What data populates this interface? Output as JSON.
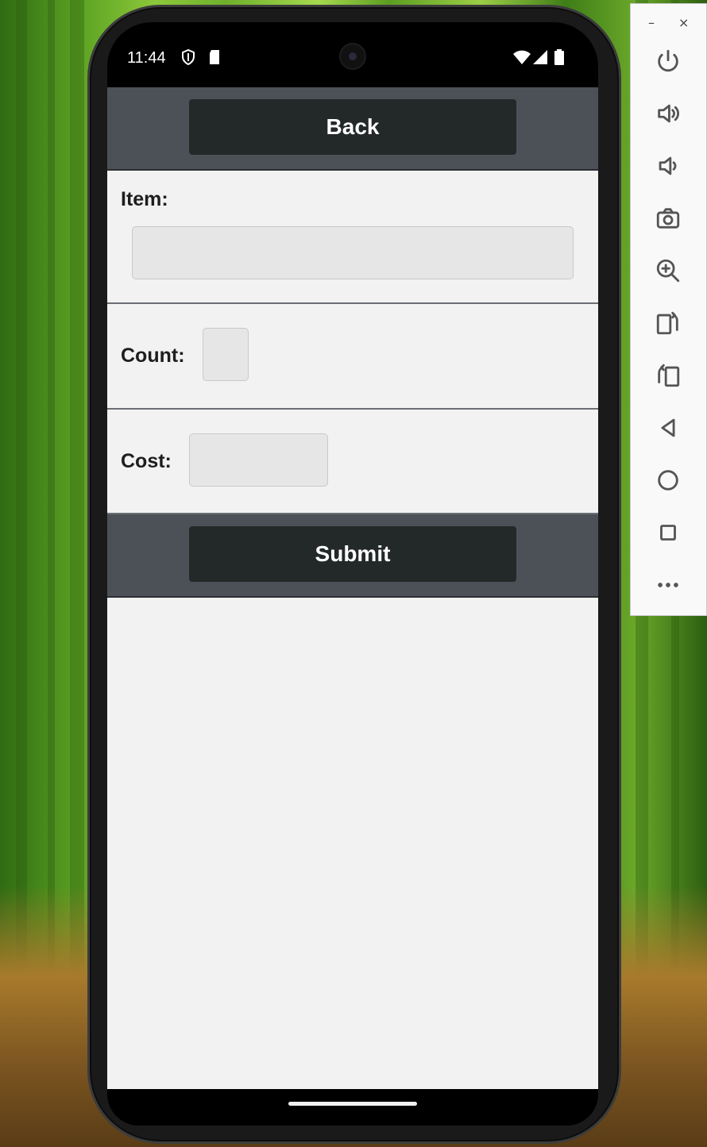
{
  "statusbar": {
    "time": "11:44"
  },
  "screen": {
    "back_label": "Back",
    "item_label": "Item:",
    "item_value": "",
    "count_label": "Count:",
    "count_value": "",
    "cost_label": "Cost:",
    "cost_value": "",
    "submit_label": "Submit"
  },
  "emulator_toolbar": {
    "minimize": "–",
    "close": "×",
    "buttons": [
      "power-icon",
      "volume-up-icon",
      "volume-down-icon",
      "camera-icon",
      "zoom-icon",
      "rotate-left-icon",
      "rotate-right-icon",
      "back-icon",
      "home-icon",
      "overview-icon",
      "more-icon"
    ]
  },
  "colors": {
    "bar": "#4b5157",
    "button": "#232829",
    "background": "#f2f2f2",
    "field": "#e6e6e6"
  }
}
